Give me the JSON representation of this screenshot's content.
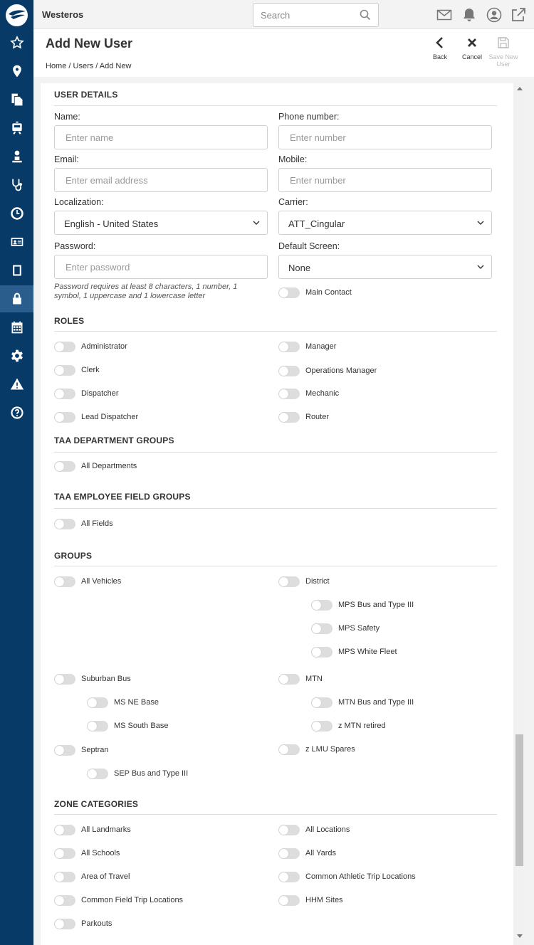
{
  "app": {
    "title": "Westeros"
  },
  "search": {
    "placeholder": "Search"
  },
  "page": {
    "title": "Add New User",
    "breadcrumb": "Home / Users / Add New"
  },
  "actions": {
    "back": "Back",
    "cancel": "Cancel",
    "save": "Save New User"
  },
  "sections": {
    "user_details": "USER DETAILS",
    "roles": "ROLES",
    "taa_department_groups": "TAA DEPARTMENT GROUPS",
    "taa_employee_field_groups": "TAA EMPLOYEE FIELD GROUPS",
    "groups": "GROUPS",
    "zone_categories": "ZONE CATEGORIES"
  },
  "form": {
    "name": {
      "label": "Name:",
      "placeholder": "Enter name"
    },
    "phone": {
      "label": "Phone number:",
      "placeholder": "Enter number"
    },
    "email": {
      "label": "Email:",
      "placeholder": "Enter email address"
    },
    "mobile": {
      "label": "Mobile:",
      "placeholder": "Enter number"
    },
    "localization": {
      "label": "Localization:",
      "value": "English - United States"
    },
    "carrier": {
      "label": "Carrier:",
      "value": "ATT_Cingular"
    },
    "password": {
      "label": "Password:",
      "placeholder": "Enter password",
      "hint": "Password requires at least 8 characters, 1 number, 1 symbol, 1 uppercase and 1 lowercase letter"
    },
    "default_screen": {
      "label": "Default Screen:",
      "value": "None"
    },
    "main_contact": "Main Contact"
  },
  "roles": [
    "Administrator",
    "Manager",
    "Clerk",
    "Operations Manager",
    "Dispatcher",
    "Mechanic",
    "Lead Dispatcher",
    "Router"
  ],
  "taa_departments": [
    "All Departments"
  ],
  "taa_fields": [
    "All Fields"
  ],
  "groups": {
    "all_vehicles": "All Vehicles",
    "district": "District",
    "mps_bus": "MPS Bus and Type III",
    "mps_safety": "MPS Safety",
    "mps_white_fleet": "MPS White Fleet",
    "suburban_bus": "Suburban Bus",
    "mtn": "MTN",
    "ms_ne_base": "MS NE Base",
    "mtn_bus": "MTN Bus and Type III",
    "ms_south_base": "MS South Base",
    "z_mtn_retired": "z MTN retired",
    "septran": "Septran",
    "z_lmu_spares": "z LMU Spares",
    "sep_bus": "SEP Bus and Type III"
  },
  "zones": [
    "All Landmarks",
    "All Locations",
    "All Schools",
    "All Yards",
    "Area of Travel",
    "Common Athletic Trip Locations",
    "Common Field Trip Locations",
    "HHM Sites",
    "Parkouts"
  ],
  "icons": {
    "sidebar": [
      "star-icon",
      "map-pin-icon",
      "documents-icon",
      "bus-icon",
      "person-icon",
      "stethoscope-icon",
      "clock-icon",
      "id-card-icon",
      "tablet-icon",
      "lock-icon",
      "calendar-icon",
      "gear-icon",
      "warning-icon",
      "help-icon"
    ]
  },
  "colors": {
    "sidebar": "#073a67",
    "sidebar_active": "#2a5d8c",
    "toggle_off": "#dddddd"
  }
}
